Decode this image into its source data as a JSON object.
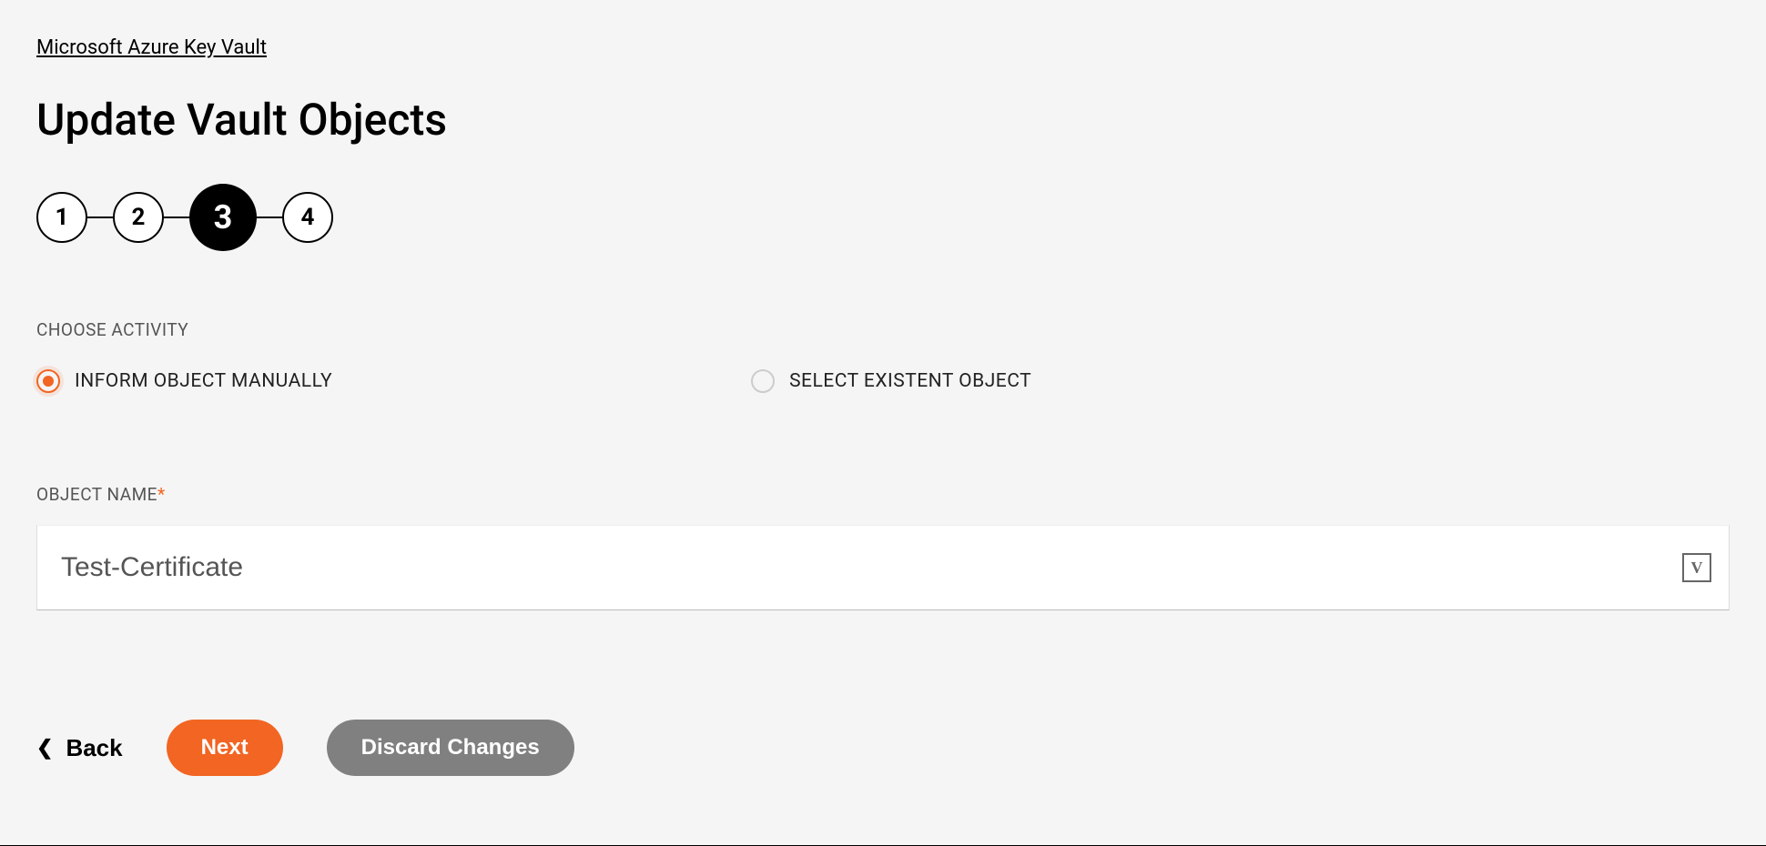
{
  "breadcrumb": "Microsoft Azure Key Vault",
  "page_title": "Update Vault Objects",
  "stepper": {
    "steps": [
      "1",
      "2",
      "3",
      "4"
    ],
    "active_index": 2
  },
  "activity": {
    "section_label": "CHOOSE ACTIVITY",
    "options": [
      {
        "label": "INFORM OBJECT MANUALLY",
        "selected": true
      },
      {
        "label": "SELECT EXISTENT OBJECT",
        "selected": false
      }
    ]
  },
  "object_name": {
    "label": "OBJECT NAME",
    "required_mark": "*",
    "value": "Test-Certificate",
    "suffix_glyph": "V"
  },
  "actions": {
    "back": "Back",
    "next": "Next",
    "discard": "Discard Changes"
  }
}
